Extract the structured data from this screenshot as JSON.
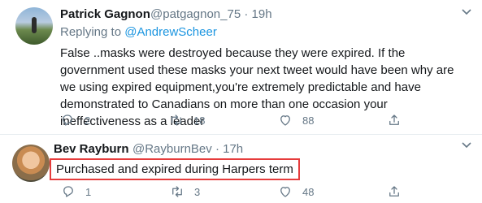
{
  "tweets": [
    {
      "author_name": "Patrick Gagnon",
      "handle": "@patgagnon_75",
      "time": "19h",
      "reply_to_prefix": "Replying to ",
      "reply_to_user": "@AndrewScheer",
      "text": "False ..masks were destroyed because they were expired. If the government used these masks your next tweet would have been why are we using expired equipment,you're extremely predictable and have demonstrated to Canadians on more than one occasion your ineffectiveness as a leader",
      "reply_count": "2",
      "retweet_count": "18",
      "like_count": "88"
    },
    {
      "author_name": "Bev Rayburn",
      "handle": "@RayburnBev",
      "time": "17h",
      "text": "Purchased and expired during Harpers term",
      "reply_count": "1",
      "retweet_count": "3",
      "like_count": "48"
    }
  ],
  "separator": "·",
  "colors": {
    "link": "#1b95e0",
    "muted": "#657786",
    "highlight_border": "#e63c3c",
    "divider": "#e6ecf0"
  },
  "icons": [
    "more-options-icon",
    "reply-icon",
    "retweet-icon",
    "like-icon",
    "share-icon"
  ]
}
